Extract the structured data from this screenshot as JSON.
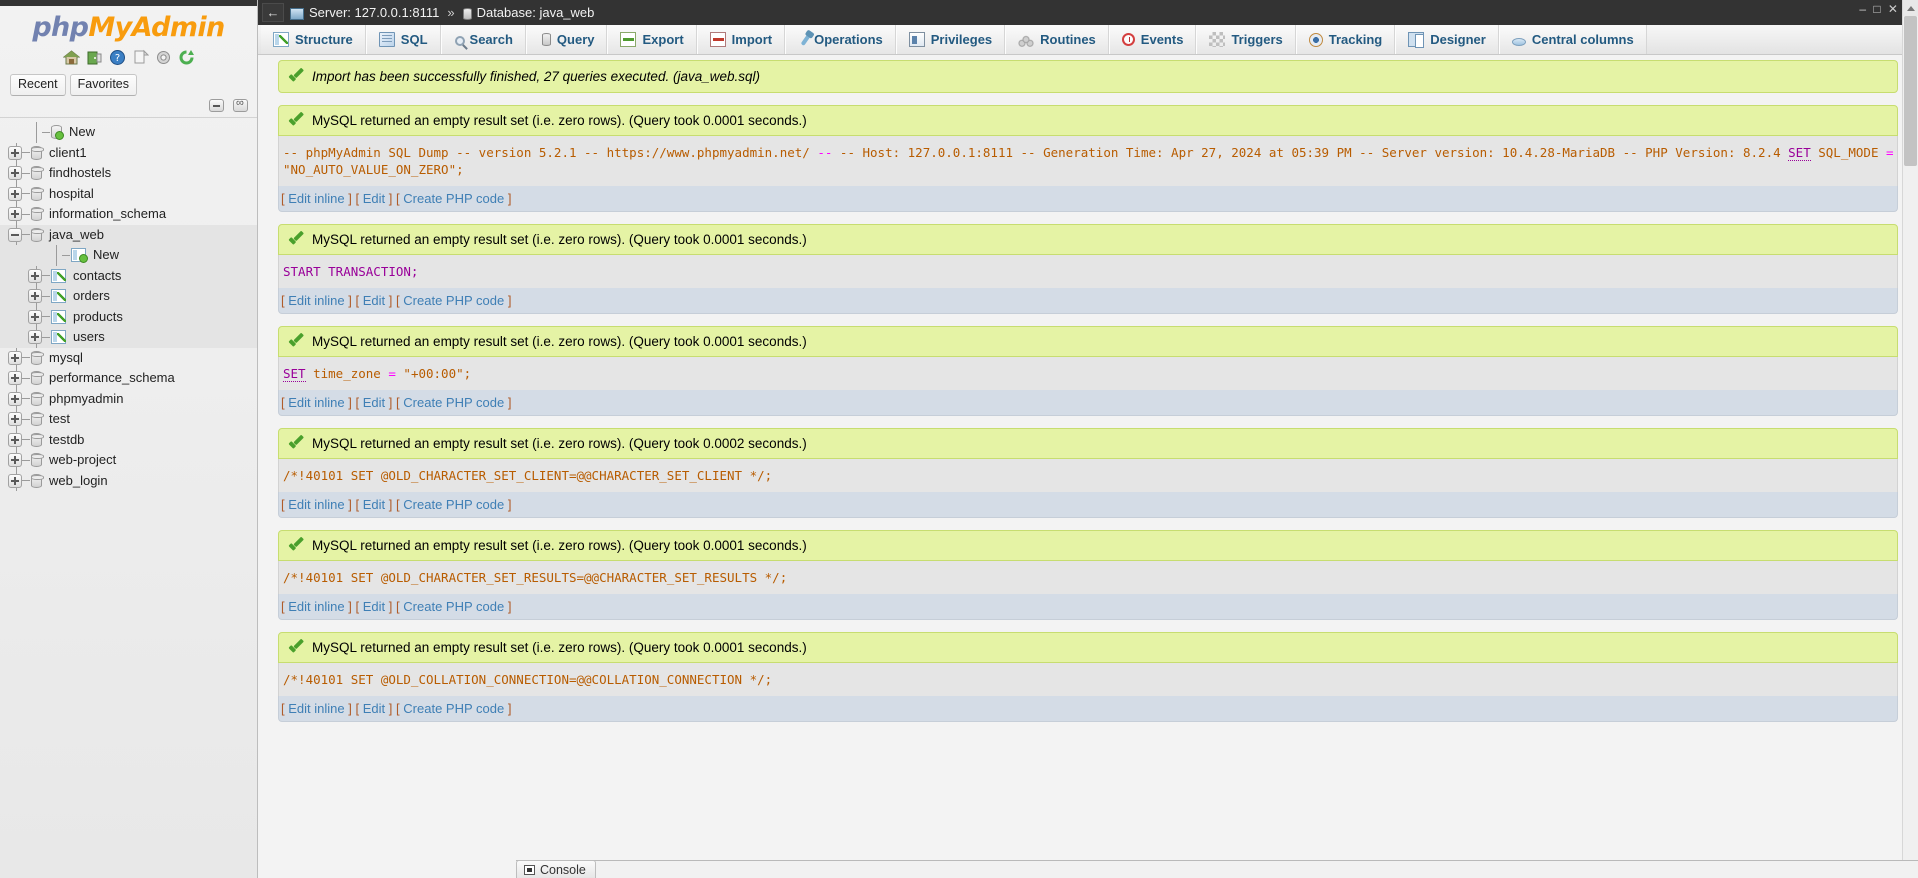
{
  "app": {
    "logo_php": "php",
    "logo_my": "My",
    "logo_admin": "Admin",
    "logo_icons": [
      "home-icon",
      "logout-icon",
      "docs-icon",
      "copy-icon",
      "settings-icon",
      "reload-icon"
    ],
    "window_controls": "– □ ✕"
  },
  "sidebar": {
    "tabs": [
      {
        "label": "Recent",
        "name": "recent"
      },
      {
        "label": "Favorites",
        "name": "favorites"
      }
    ],
    "collapse_icons": [
      "collapse-all-icon",
      "link-with-main-panel-icon"
    ],
    "tree": [
      {
        "label": "New",
        "icon": "new-database-icon",
        "toggle": "none",
        "depth": 1,
        "selected": false
      },
      {
        "label": "client1",
        "icon": "database-icon",
        "toggle": "plus",
        "depth": 0,
        "selected": false
      },
      {
        "label": "findhostels",
        "icon": "database-icon",
        "toggle": "plus",
        "depth": 0,
        "selected": false
      },
      {
        "label": "hospital",
        "icon": "database-icon",
        "toggle": "plus",
        "depth": 0,
        "selected": false
      },
      {
        "label": "information_schema",
        "icon": "database-icon",
        "toggle": "plus",
        "depth": 0,
        "selected": false
      },
      {
        "label": "java_web",
        "icon": "database-icon",
        "toggle": "minus",
        "depth": 0,
        "selected": true
      },
      {
        "label": "New",
        "icon": "new-table-icon",
        "toggle": "none",
        "depth": 2,
        "selected": true
      },
      {
        "label": "contacts",
        "icon": "table-icon",
        "toggle": "plus",
        "depth": 1,
        "selected": true
      },
      {
        "label": "orders",
        "icon": "table-icon",
        "toggle": "plus",
        "depth": 1,
        "selected": true
      },
      {
        "label": "products",
        "icon": "table-icon",
        "toggle": "plus",
        "depth": 1,
        "selected": true
      },
      {
        "label": "users",
        "icon": "table-icon",
        "toggle": "plus",
        "depth": 1,
        "selected": true
      },
      {
        "label": "mysql",
        "icon": "database-icon",
        "toggle": "plus",
        "depth": 0,
        "selected": false
      },
      {
        "label": "performance_schema",
        "icon": "database-icon",
        "toggle": "plus",
        "depth": 0,
        "selected": false
      },
      {
        "label": "phpmyadmin",
        "icon": "database-icon",
        "toggle": "plus",
        "depth": 0,
        "selected": false
      },
      {
        "label": "test",
        "icon": "database-icon",
        "toggle": "plus",
        "depth": 0,
        "selected": false
      },
      {
        "label": "testdb",
        "icon": "database-icon",
        "toggle": "plus",
        "depth": 0,
        "selected": false
      },
      {
        "label": "web-project",
        "icon": "database-icon",
        "toggle": "plus",
        "depth": 0,
        "selected": false
      },
      {
        "label": "web_login",
        "icon": "database-icon",
        "toggle": "plus",
        "depth": 0,
        "selected": false
      }
    ]
  },
  "breadcrumb": {
    "back_label": "←",
    "server_label": "Server: 127.0.0.1:8111",
    "separator": "»",
    "database_label": "Database: java_web"
  },
  "tabs": [
    {
      "label": "Structure",
      "icon": "structure-icon"
    },
    {
      "label": "SQL",
      "icon": "sql-icon"
    },
    {
      "label": "Search",
      "icon": "search-icon"
    },
    {
      "label": "Query",
      "icon": "query-icon"
    },
    {
      "label": "Export",
      "icon": "export-icon"
    },
    {
      "label": "Import",
      "icon": "import-icon"
    },
    {
      "label": "Operations",
      "icon": "operations-icon"
    },
    {
      "label": "Privileges",
      "icon": "privileges-icon"
    },
    {
      "label": "Routines",
      "icon": "routines-icon"
    },
    {
      "label": "Events",
      "icon": "events-icon"
    },
    {
      "label": "Triggers",
      "icon": "triggers-icon"
    },
    {
      "label": "Tracking",
      "icon": "tracking-icon"
    },
    {
      "label": "Designer",
      "icon": "designer-icon"
    },
    {
      "label": "Central columns",
      "icon": "central-columns-icon"
    }
  ],
  "import_notice": "Import has been successfully finished, 27 queries executed. (java_web.sql)",
  "links": {
    "edit_inline": "Edit inline",
    "edit": "Edit",
    "create_php": "Create PHP code",
    "open_bracket": "[",
    "close_bracket": "]"
  },
  "queries": [
    {
      "status": "MySQL returned an empty result set (i.e. zero rows). (Query took 0.0001 seconds.)",
      "sql_parts": [
        {
          "t": "-- phpMyAdmin SQL Dump -- version 5.2.1 -- https://www.phpmyadmin.net/ ",
          "c": "comment"
        },
        {
          "t": "--",
          "c": "op"
        },
        {
          "t": " -- Host: 127.0.0.1:8111 -- Generation Time: Apr 27, 2024 at 05:39 PM -- Server version: 10.4.28-MariaDB -- PHP Version: 8.2.4 ",
          "c": "comment"
        },
        {
          "t": "SET",
          "c": "kwu"
        },
        {
          "t": " SQL_MODE ",
          "c": "comment"
        },
        {
          "t": "=",
          "c": "op"
        },
        {
          "t": " \"NO_AUTO_VALUE_ON_ZERO\";",
          "c": "comment"
        }
      ]
    },
    {
      "status": "MySQL returned an empty result set (i.e. zero rows). (Query took 0.0001 seconds.)",
      "sql_parts": [
        {
          "t": "START TRANSACTION;",
          "c": "kw"
        }
      ]
    },
    {
      "status": "MySQL returned an empty result set (i.e. zero rows). (Query took 0.0001 seconds.)",
      "sql_parts": [
        {
          "t": "SET",
          "c": "kwu"
        },
        {
          "t": " time_zone ",
          "c": "comment"
        },
        {
          "t": "=",
          "c": "op"
        },
        {
          "t": " \"+00:00\";",
          "c": "comment"
        }
      ]
    },
    {
      "status": "MySQL returned an empty result set (i.e. zero rows). (Query took 0.0002 seconds.)",
      "sql_parts": [
        {
          "t": "/*!40101 SET @OLD_CHARACTER_SET_CLIENT=@@CHARACTER_SET_CLIENT */;",
          "c": "comment"
        }
      ]
    },
    {
      "status": "MySQL returned an empty result set (i.e. zero rows). (Query took 0.0001 seconds.)",
      "sql_parts": [
        {
          "t": "/*!40101 SET @OLD_CHARACTER_SET_RESULTS=@@CHARACTER_SET_RESULTS */;",
          "c": "comment"
        }
      ]
    },
    {
      "status": "MySQL returned an empty result set (i.e. zero rows). (Query took 0.0001 seconds.)",
      "sql_parts": [
        {
          "t": "/*!40101 SET @OLD_COLLATION_CONNECTION=@@COLLATION_CONNECTION */;",
          "c": "comment"
        }
      ]
    }
  ],
  "console": {
    "label": "Console",
    "icon": "console-icon"
  },
  "colors": {
    "success_bg": "#e5f3a5",
    "success_border": "#c7dd70",
    "sql_bg": "#e5e5e5",
    "footer_bg": "#d4dce6",
    "link": "#3f7fb5",
    "brand_orange": "#f89c0e",
    "brand_blue": "#7282b0",
    "topbar_dark": "#333333"
  }
}
